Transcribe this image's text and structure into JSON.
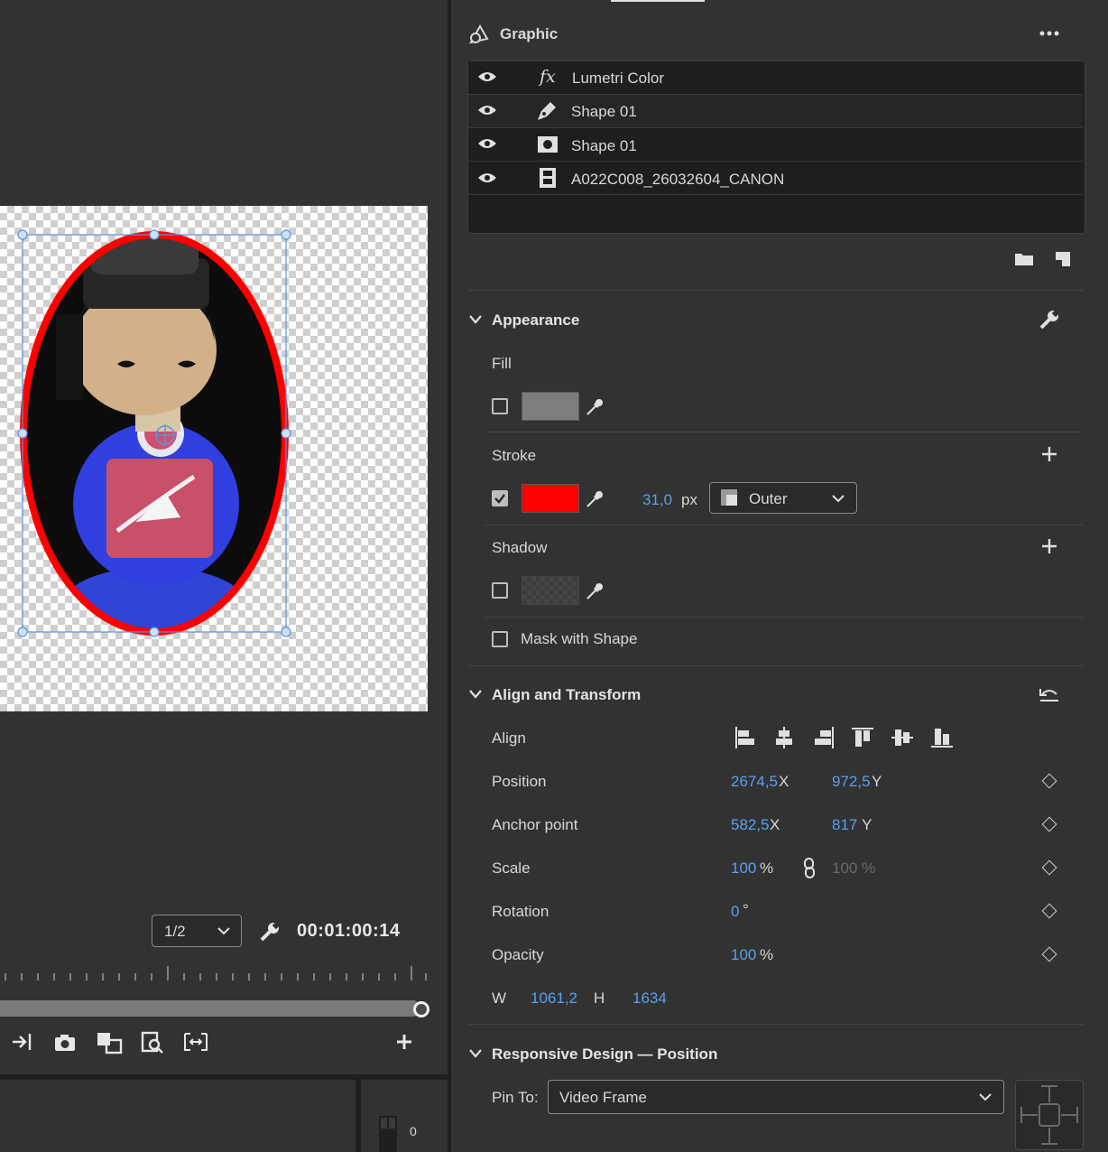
{
  "monitor": {
    "resolution": "1/2",
    "timecode": "00:01:00:14",
    "meter_value": "0"
  },
  "graphic_panel": {
    "title": "Graphic",
    "layers": [
      {
        "icon": "fx-icon",
        "name": "Lumetri Color"
      },
      {
        "icon": "pen-icon",
        "name": "Shape 01"
      },
      {
        "icon": "shape-icon",
        "name": "Shape 01"
      },
      {
        "icon": "film-icon",
        "name": "A022C008_26032604_CANON"
      }
    ]
  },
  "appearance": {
    "title": "Appearance",
    "fill_label": "Fill",
    "fill_color": "#7d7d7d",
    "stroke_label": "Stroke",
    "stroke_color": "#ff0000",
    "stroke_width": "31,0",
    "stroke_unit": "px",
    "stroke_type": "Outer",
    "shadow_label": "Shadow",
    "mask_label": "Mask with Shape"
  },
  "transform": {
    "title": "Align and Transform",
    "align_label": "Align",
    "position_label": "Position",
    "position_x": "2674,5",
    "position_y": "972,5",
    "anchor_label": "Anchor point",
    "anchor_x": "582,5",
    "anchor_y": "817",
    "scale_label": "Scale",
    "scale_value": "100",
    "scale_unit": "%",
    "scale_linked": "100 %",
    "rotation_label": "Rotation",
    "rotation_value": "0",
    "rotation_unit": "°",
    "opacity_label": "Opacity",
    "opacity_value": "100",
    "opacity_unit": "%",
    "x_label": "X",
    "y_label": "Y",
    "w_label": "W",
    "w_value": "1061,2",
    "h_label": "H",
    "h_value": "1634"
  },
  "responsive": {
    "title": "Responsive Design — Position",
    "pin_label": "Pin To:",
    "pin_value": "Video Frame"
  }
}
